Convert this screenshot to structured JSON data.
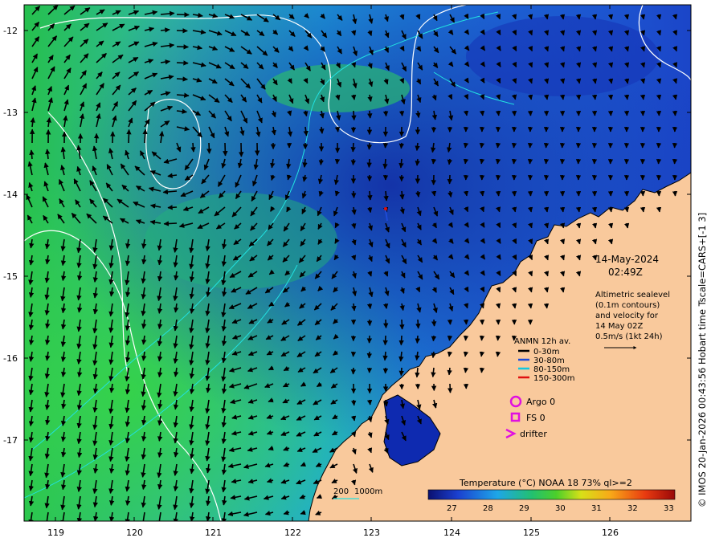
{
  "map": {
    "date": "14-May-2024",
    "time": "02:49Z",
    "altimetry_lines": [
      "Altimetric sealevel",
      "(0.1m contours)",
      "and velocity for",
      "14 May 02Z",
      "0.5m/s (1kt 24h)"
    ],
    "side_caption": "© IMOS 20-Jan-2026 00:43:56 Hobart time Tscale=CARS+[-1 3]",
    "lat_ticks": [
      "-12",
      "-13",
      "-14",
      "-15",
      "-16",
      "-17"
    ],
    "lon_ticks": [
      "119",
      "120",
      "121",
      "122",
      "123",
      "124",
      "125",
      "126"
    ],
    "mooring_legend": {
      "title": "ANMN 12h av.",
      "items": [
        {
          "label": "0-30m",
          "color": "#000000"
        },
        {
          "label": "30-80m",
          "color": "#1e4bd8"
        },
        {
          "label": "80-150m",
          "color": "#10c8e0"
        },
        {
          "label": "150-300m",
          "color": "#e01010"
        }
      ]
    },
    "obs_legend": {
      "argo": "Argo 0",
      "fs": "FS 0",
      "drifter": "drifter",
      "marker_color": "#e010e0"
    },
    "depth_legend": {
      "label_a": "200",
      "label_b": "1000m"
    },
    "colorbar": {
      "title": "Temperature (°C) NOAA 18 73% ql>=2",
      "ticks": [
        "27",
        "28",
        "29",
        "30",
        "31",
        "32",
        "33"
      ]
    },
    "colors": {
      "land": "#f9c99c",
      "warm_water": "#2bc95a",
      "cool_water": "#1a5fe0",
      "contour_white": "#ffffff",
      "contour_cyan": "#22e0e0"
    }
  }
}
